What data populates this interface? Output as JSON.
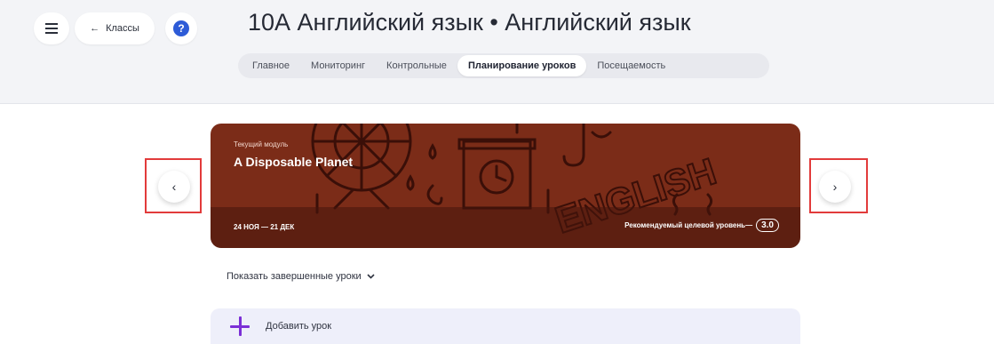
{
  "header": {
    "back_label": "Классы",
    "title": "10А Английский язык • Английский язык",
    "tabs": [
      {
        "label": "Главное",
        "active": false
      },
      {
        "label": "Мониторинг",
        "active": false
      },
      {
        "label": "Контрольные",
        "active": false
      },
      {
        "label": "Планирование уроков",
        "active": true
      },
      {
        "label": "Посещаемость",
        "active": false
      }
    ]
  },
  "module": {
    "label": "Текущий модуль",
    "name": "A Disposable Planet",
    "dates": "24 НОЯ — 21 ДЕК",
    "level_label": "Рекомендуемый целевой уровень—",
    "level_value": "3.0",
    "banner_text": "ENGLISH"
  },
  "nav": {
    "prev_glyph": "‹",
    "next_glyph": "›"
  },
  "lessons": {
    "show_completed": "Показать завершенные уроки",
    "add_lesson": "Добавить урок"
  },
  "colors": {
    "accent": "#2d5bd7",
    "banner": "#7b2c18",
    "highlight": "#e23b3b",
    "plus": "#7b2fd6"
  }
}
